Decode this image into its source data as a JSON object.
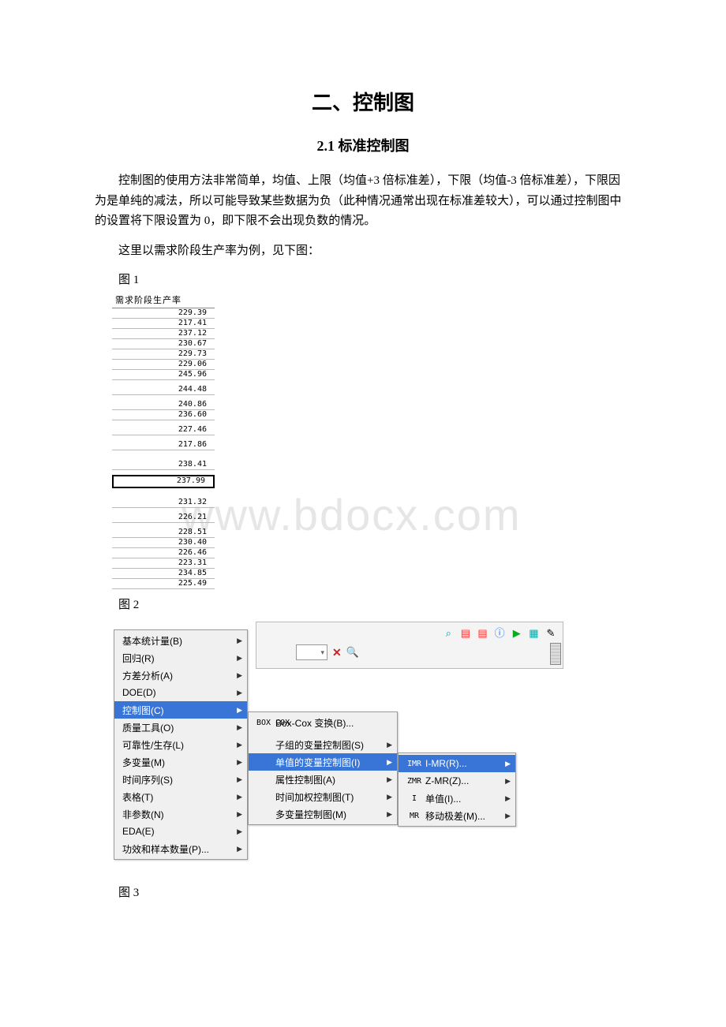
{
  "title": "二、控制图",
  "subtitle": "2.1 标准控制图",
  "para1": "控制图的使用方法非常简单，均值、上限（均值+3 倍标准差），下限（均值-3 倍标准差），下限因为是单纯的减法，所以可能导致某些数据为负（此种情况通常出现在标准差较大），可以通过控制图中的设置将下限设置为 0，即下限不会出现负数的情况。",
  "para2": "这里以需求阶段生产率为例，见下图：",
  "fig1_label": "图 1",
  "fig2_label": "图 2",
  "fig3_label": "图 3",
  "watermark": "www.bdocx.com",
  "fig1": {
    "header": "需求阶段生产率",
    "values": [
      "229.39",
      "217.41",
      "237.12",
      "230.67",
      "229.73",
      "229.06",
      "245.96",
      "",
      "244.48",
      "",
      "240.86",
      "236.60",
      "",
      "227.46",
      "",
      "217.86",
      "",
      "",
      "238.41",
      "",
      "237.99",
      "",
      "",
      "231.32",
      "",
      "226.21",
      "",
      "228.51",
      "230.40",
      "226.46",
      "223.31",
      "234.85",
      "225.49"
    ],
    "selected_index": 20
  },
  "fig2": {
    "toolbar_icons": [
      "🔍",
      "📄",
      "📄",
      "ℹ",
      "▶",
      "📋",
      "✎"
    ],
    "menu1": [
      {
        "label": "基本统计量(B)",
        "hl": false
      },
      {
        "label": "回归(R)",
        "hl": false
      },
      {
        "label": "方差分析(A)",
        "hl": false
      },
      {
        "label": "DOE(D)",
        "hl": false
      },
      {
        "label": "控制图(C)",
        "hl": true
      },
      {
        "label": "质量工具(O)",
        "hl": false
      },
      {
        "label": "可靠性/生存(L)",
        "hl": false
      },
      {
        "label": "多变量(M)",
        "hl": false
      },
      {
        "label": "时间序列(S)",
        "hl": false
      },
      {
        "label": "表格(T)",
        "hl": false
      },
      {
        "label": "非参数(N)",
        "hl": false
      },
      {
        "label": "EDA(E)",
        "hl": false
      },
      {
        "label": "功效和样本数量(P)...",
        "hl": false
      }
    ],
    "menu2": [
      {
        "icon": "BOX\nCOX",
        "label": "Box-Cox 变换(B)...",
        "arrow": false,
        "hl": false,
        "gapAfter": true
      },
      {
        "icon": "",
        "label": "子组的变量控制图(S)",
        "arrow": true,
        "hl": false
      },
      {
        "icon": "",
        "label": "单值的变量控制图(I)",
        "arrow": true,
        "hl": true
      },
      {
        "icon": "",
        "label": "属性控制图(A)",
        "arrow": true,
        "hl": false
      },
      {
        "icon": "",
        "label": "时间加权控制图(T)",
        "arrow": true,
        "hl": false
      },
      {
        "icon": "",
        "label": "多变量控制图(M)",
        "arrow": true,
        "hl": false
      }
    ],
    "menu3": [
      {
        "icon": "IMR",
        "label": "I-MR(R)...",
        "hl": true
      },
      {
        "icon": "ZMR",
        "label": "Z-MR(Z)...",
        "hl": false
      },
      {
        "icon": "I",
        "label": "单值(I)...",
        "hl": false
      },
      {
        "icon": "MR",
        "label": "移动极差(M)...",
        "hl": false
      }
    ]
  }
}
